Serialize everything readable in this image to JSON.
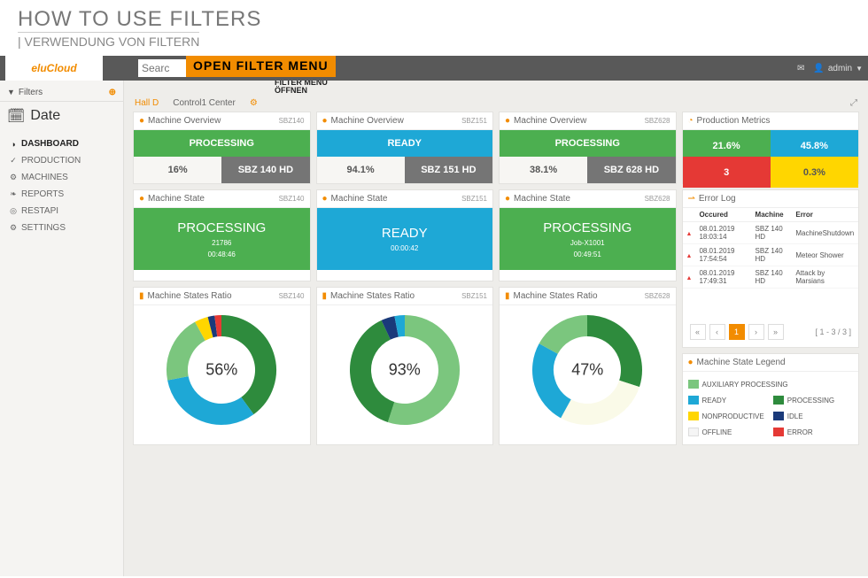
{
  "heading": {
    "title": "HOW TO USE FILTERS",
    "subtitle": "| VERWENDUNG VON FILTERN"
  },
  "topbar": {
    "logo": "eluCloud",
    "search_placeholder": "Searc",
    "annotation": "OPEN FILTER MENU",
    "sub_annotation1": "FILTER MENÜ",
    "sub_annotation2": "ÖFFNEN",
    "user": "admin"
  },
  "sidebar": {
    "filters_label": "Filters",
    "date_label": "Date",
    "nav": [
      {
        "label": "DASHBOARD",
        "icon": "◑",
        "active": true
      },
      {
        "label": "PRODUCTION",
        "icon": "✓",
        "active": false
      },
      {
        "label": "MACHINES",
        "icon": "⚙",
        "active": false
      },
      {
        "label": "REPORTS",
        "icon": "❧",
        "active": false
      },
      {
        "label": "RESTAPI",
        "icon": "◎",
        "active": false
      },
      {
        "label": "SETTINGS",
        "icon": "⚙",
        "active": false
      }
    ]
  },
  "breadcrumbs": {
    "items": [
      "Hall D",
      "Control1 Center"
    ],
    "active": 0
  },
  "overview": [
    {
      "title": "Machine Overview",
      "tag": "SBZ140",
      "state": "PROCESSING",
      "state_class": "green",
      "pct": "16%",
      "model": "SBZ 140 HD"
    },
    {
      "title": "Machine Overview",
      "tag": "SBZ151",
      "state": "READY",
      "state_class": "blue",
      "pct": "94.1%",
      "model": "SBZ 151 HD"
    },
    {
      "title": "Machine Overview",
      "tag": "SBZ628",
      "state": "PROCESSING",
      "state_class": "green",
      "pct": "38.1%",
      "model": "SBZ 628 HD"
    }
  ],
  "metrics": {
    "title": "Production Metrics",
    "row1": [
      {
        "val": "21.6%",
        "cls": "green"
      },
      {
        "val": "45.8%",
        "cls": "blue"
      }
    ],
    "row2": [
      {
        "val": "3",
        "cls": "red"
      },
      {
        "val": "0.3%",
        "cls": "yellow"
      }
    ]
  },
  "state": [
    {
      "title": "Machine State",
      "tag": "SBZ140",
      "body_cls": "green",
      "label": "PROCESSING",
      "sub1": "21786",
      "sub2": "00:48:46"
    },
    {
      "title": "Machine State",
      "tag": "SBZ151",
      "body_cls": "blue",
      "label": "READY",
      "sub1": "",
      "sub2": "00:00:42"
    },
    {
      "title": "Machine State",
      "tag": "SBZ628",
      "body_cls": "green",
      "label": "PROCESSING",
      "sub1": "Job-X1001",
      "sub2": "00:49:51"
    }
  ],
  "errorlog": {
    "title": "Error Log",
    "headers": [
      "Occured",
      "Machine",
      "Error"
    ],
    "rows": [
      {
        "date": "08.01.2019 18:03:14",
        "machine": "SBZ 140 HD",
        "error": "MachineShutdown"
      },
      {
        "date": "08.01.2019 17:54:54",
        "machine": "SBZ 140 HD",
        "error": "Meteor Shower"
      },
      {
        "date": "08.01.2019 17:49:31",
        "machine": "SBZ 140 HD",
        "error": "Attack by Marsians"
      }
    ],
    "page": "1",
    "page_info": "[ 1 - 3 / 3 ]"
  },
  "ratio": [
    {
      "title": "Machine States Ratio",
      "tag": "SBZ140",
      "center": "56%"
    },
    {
      "title": "Machine States Ratio",
      "tag": "SBZ151",
      "center": "93%"
    },
    {
      "title": "Machine States Ratio",
      "tag": "SBZ628",
      "center": "47%"
    }
  ],
  "chart_data": [
    {
      "type": "pie",
      "title": "Machine States Ratio SBZ140",
      "center_label": "56%",
      "series": [
        {
          "name": "PROCESSING",
          "color": "#2e8b3d",
          "value": 40
        },
        {
          "name": "READY",
          "color": "#1ea8d6",
          "value": 32
        },
        {
          "name": "AUXILIARY PROCESSING",
          "color": "#7bc67e",
          "value": 20
        },
        {
          "name": "NONPRODUCTIVE",
          "color": "#ffd600",
          "value": 4
        },
        {
          "name": "IDLE",
          "color": "#1a3a7a",
          "value": 2
        },
        {
          "name": "ERROR",
          "color": "#e53935",
          "value": 2
        }
      ]
    },
    {
      "type": "pie",
      "title": "Machine States Ratio SBZ151",
      "center_label": "93%",
      "series": [
        {
          "name": "AUXILIARY PROCESSING",
          "color": "#7bc67e",
          "value": 55
        },
        {
          "name": "PROCESSING",
          "color": "#2e8b3d",
          "value": 38
        },
        {
          "name": "IDLE",
          "color": "#1a3a7a",
          "value": 4
        },
        {
          "name": "READY",
          "color": "#1ea8d6",
          "value": 3
        }
      ]
    },
    {
      "type": "pie",
      "title": "Machine States Ratio SBZ628",
      "center_label": "47%",
      "series": [
        {
          "name": "PROCESSING",
          "color": "#2e8b3d",
          "value": 30
        },
        {
          "name": "OFFLINE",
          "color": "#fafae8",
          "value": 28
        },
        {
          "name": "READY",
          "color": "#1ea8d6",
          "value": 25
        },
        {
          "name": "AUXILIARY PROCESSING",
          "color": "#7bc67e",
          "value": 17
        }
      ]
    }
  ],
  "legend": {
    "title": "Machine State Legend",
    "items": [
      {
        "label": "AUXILIARY PROCESSING",
        "cls": "aux",
        "span": 2
      },
      {
        "label": "READY",
        "cls": "ready"
      },
      {
        "label": "PROCESSING",
        "cls": "proc"
      },
      {
        "label": "NONPRODUCTIVE",
        "cls": "nonp"
      },
      {
        "label": "IDLE",
        "cls": "idle"
      },
      {
        "label": "OFFLINE",
        "cls": "off"
      },
      {
        "label": "ERROR",
        "cls": "err"
      }
    ]
  }
}
